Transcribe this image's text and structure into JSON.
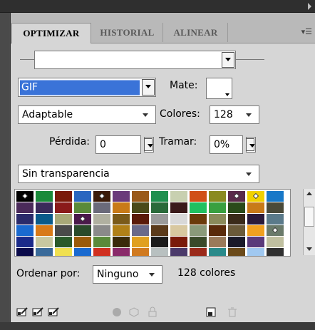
{
  "tabs": [
    {
      "label": "OPTIMIZAR",
      "active": true
    },
    {
      "label": "HISTORIAL",
      "active": false
    },
    {
      "label": "ALINEAR",
      "active": false
    }
  ],
  "preset": {
    "value": ""
  },
  "format": {
    "value": "GIF"
  },
  "mate": {
    "label": "Mate:"
  },
  "reduction": {
    "value": "Adaptable"
  },
  "colors": {
    "label": "Colores:",
    "value": "128"
  },
  "loss": {
    "label": "Pérdida:",
    "value": "0"
  },
  "dither": {
    "label": "Tramar:",
    "value": "0%"
  },
  "transparency": {
    "value": "Sin transparencia"
  },
  "sort": {
    "label": "Ordenar por:",
    "value": "Ninguno"
  },
  "color_count": "128 colores",
  "palette": {
    "rows": [
      [
        "#000000",
        "#1a8a3a",
        "#7a1a0a",
        "#2a66c0",
        "#3a1a08",
        "#6a3a7a",
        "#9a5a1a",
        "#1f8f4f",
        "#c8d0b0",
        "#d05018",
        "#8a8a20",
        "#5a2a4a",
        "#f0d000",
        "#1878c8"
      ],
      [
        "#4a2a5a",
        "#3a2a5a",
        "#8a1a1a",
        "#5a8a3a",
        "#6a6a7a",
        "#c87a18",
        "#4a4a1a",
        "#2a6a3a",
        "#3a1a1a",
        "#20c060",
        "#38a040",
        "#2a4a1a",
        "#c87a18",
        "#4a4a3a"
      ],
      [
        "#2a2a6a",
        "#0a5a8a",
        "#a8a878",
        "#4a1a4a",
        "#b0b0a0",
        "#7a5a1a",
        "#5a1a0a",
        "#9a9a9a",
        "#d8d8d8",
        "#6a3a0a",
        "#8a8a5a",
        "#3a2a1a",
        "#2a1a3a",
        "#5a7a8a"
      ],
      [
        "#1a6ad0",
        "#d87a18",
        "#4a4a4a",
        "#2a4a2a",
        "#8a8a8a",
        "#b08018",
        "#6a6a8a",
        "#5a3a1a",
        "#d8c8a0",
        "#8a9a7a",
        "#5a2a0a",
        "#6a5a3a",
        "#f0a020",
        "#6a7a6a"
      ],
      [
        "#1a2a8a",
        "#c8c8a0",
        "#2a5a2a",
        "#9a5a0a",
        "#5a8a3a",
        "#3a2a0a",
        "#e0a020",
        "#1a1a1a",
        "#7a1a0a",
        "#3a4a2a",
        "#9a7a5a",
        "#1a1a2a",
        "#5a3a7a",
        "#c0c0a0"
      ],
      [
        "#0a0a4a",
        "#3a6a9a",
        "#f0e050",
        "#1a6ad0",
        "#d03020",
        "#8a2a6a",
        "#d07a20",
        "#b8c0c0",
        "#4a3a6a",
        "#9a2a1a",
        "#2a8a8a",
        "#6a4a1a",
        "#a0c8f0",
        "#303030"
      ]
    ],
    "marked": [
      [
        0,
        0
      ],
      [
        0,
        4
      ],
      [
        0,
        11
      ],
      [
        0,
        12
      ],
      [
        2,
        3
      ],
      [
        3,
        13
      ]
    ]
  },
  "toolbar": [
    {
      "icon": "map-color-transparent-icon",
      "enabled": true
    },
    {
      "icon": "map-color-web-icon",
      "enabled": true
    },
    {
      "icon": "lock-color-icon",
      "enabled": true
    },
    {
      "icon": "circle-disabled-icon",
      "enabled": false
    },
    {
      "icon": "cube-disabled-icon",
      "enabled": false
    },
    {
      "icon": "lock-disabled-icon",
      "enabled": false
    },
    {
      "icon": "new-color-icon",
      "enabled": true
    },
    {
      "icon": "trash-icon",
      "enabled": false
    }
  ]
}
